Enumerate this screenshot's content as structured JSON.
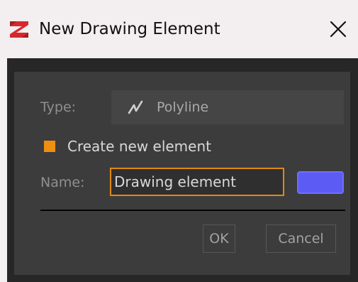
{
  "window": {
    "title": "New Drawing Element",
    "app_icon": "zbrush-logo-icon",
    "close_icon": "close-icon"
  },
  "form": {
    "type_label": "Type:",
    "type_value": "Polyline",
    "type_icon": "polyline-icon",
    "create_new_label": "Create new element",
    "create_new_checked": true,
    "name_label": "Name:",
    "name_value": "Drawing element",
    "element_color": "#5c5cf5"
  },
  "buttons": {
    "ok_label": "OK",
    "cancel_label": "Cancel"
  },
  "colors": {
    "accent": "#ef8f0f",
    "panel_bg": "#3c3c3c",
    "frame_bg": "#272727"
  }
}
